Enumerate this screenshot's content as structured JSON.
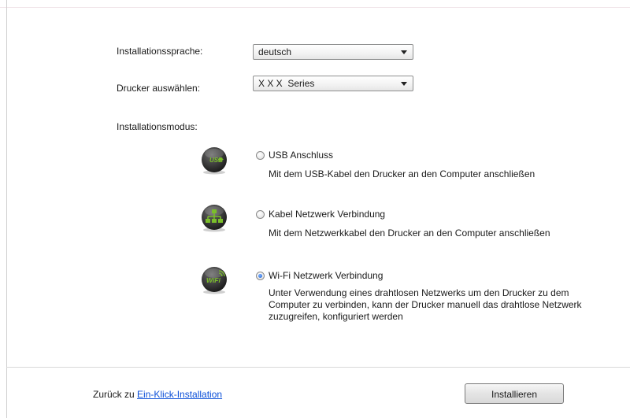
{
  "form": {
    "language_label": "Installationssprache:",
    "language_value": "deutsch",
    "printer_label": "Drucker auswählen:",
    "printer_value": "X X X  Series",
    "mode_label": "Installationsmodus:"
  },
  "modes": [
    {
      "icon": "usb-icon",
      "icon_text": "USB",
      "title": "USB Anschluss",
      "description": "Mit dem USB-Kabel den Drucker an den Computer anschließen",
      "selected": false
    },
    {
      "icon": "network-icon",
      "title": "Kabel Netzwerk Verbindung",
      "description": "Mit dem Netzwerkkabel den Drucker an den Computer anschließen",
      "selected": false
    },
    {
      "icon": "wifi-icon",
      "icon_text": "WiFi",
      "title": "Wi-Fi Netzwerk Verbindung",
      "description": "Unter Verwendung eines drahtlosen Netzwerks um den Drucker zu dem Computer zu verbinden, kann der Drucker manuell das drahtlose Netzwerk zuzugreifen, konfiguriert werden",
      "selected": true
    }
  ],
  "footer": {
    "back_prefix": "Zurück zu",
    "back_link": "Ein-Klick-Installation",
    "install_button": "Installieren"
  },
  "colors": {
    "link": "#0b4fd8",
    "icon_dark": "#2c2c2c",
    "icon_green": "#7bbf2a"
  }
}
